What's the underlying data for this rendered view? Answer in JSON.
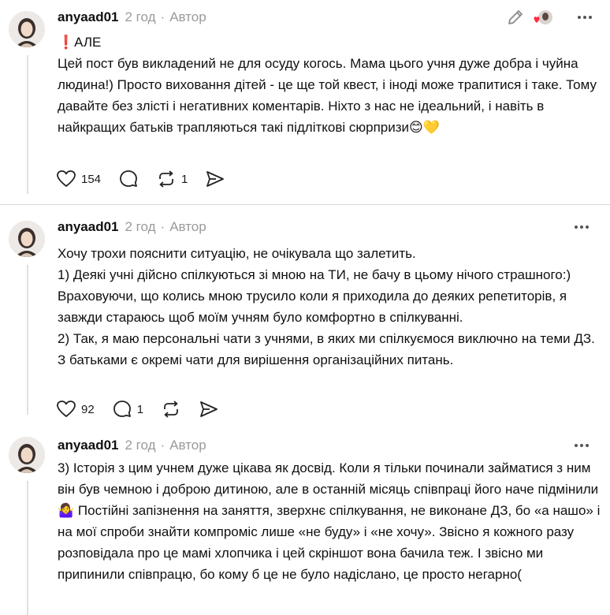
{
  "posts": [
    {
      "username": "anyaad01",
      "time": "2 год",
      "role": "Автор",
      "paragraphs": [
        "❗АЛЕ",
        "Цей пост був викладений не для осуду когось. Мама цього учня дуже добра і чуйна людина!) Просто виховання дітей - це ще той квест, і іноді може трапитися і таке. Тому давайте без злісті і негативних коментарів. Ніхто з нас не ідеальний, і навіть в найкращих батьків трапляються такі підліткові сюрпризи😊💛"
      ],
      "likes": "154",
      "replies": "",
      "reposts": "1",
      "icons": {
        "edit": "pencil-icon",
        "liked_by": "liked-by-avatar-icon",
        "more": "more-dots-icon"
      }
    },
    {
      "username": "anyaad01",
      "time": "2 год",
      "role": "Автор",
      "paragraphs": [
        "Хочу трохи пояснити ситуацію, не очікувала що залетить.",
        "1) Деякі учні дійсно спілкуються зі мною на ТИ, не бачу в цьому нічого страшного:) Враховуючи, що колись мною трусило коли я приходила до деяких репетиторів, я завжди стараюсь щоб моїм учням було комфортно в спілкуванні.",
        "2) Так, я маю персональні чати з учнями, в яких ми спілкуємося виключно на теми ДЗ. З батьками є окремі чати для вирішення організаційних питань."
      ],
      "likes": "92",
      "replies": "1",
      "reposts": "",
      "icons": {
        "more": "more-dots-icon"
      }
    },
    {
      "username": "anyaad01",
      "time": "2 год",
      "role": "Автор",
      "paragraphs": [
        "3) Історія з цим учнем дуже цікава як досвід. Коли я тільки починали займатися з ним він був чемною і доброю дитиною, але в останній місяць співпраці його наче підмінили🤷‍♀️ Постійні запізнення на заняття, зверхнє спілкування, не виконане ДЗ, бо «а нашо» і на мої спроби знайти компроміс лише «не буду» і «не хочу». Звісно я кожного разу розповідала про це мамі хлопчика і цей скріншот вона бачила теж. І звісно ми припинили співпрацю, бо кому б це не було надіслано, це просто негарно("
      ],
      "icons": {
        "more": "more-dots-icon"
      }
    }
  ],
  "colors": {
    "text": "#101010",
    "muted": "#9a9a9a",
    "divider": "#dadada",
    "like_heart": "#ff3040"
  }
}
